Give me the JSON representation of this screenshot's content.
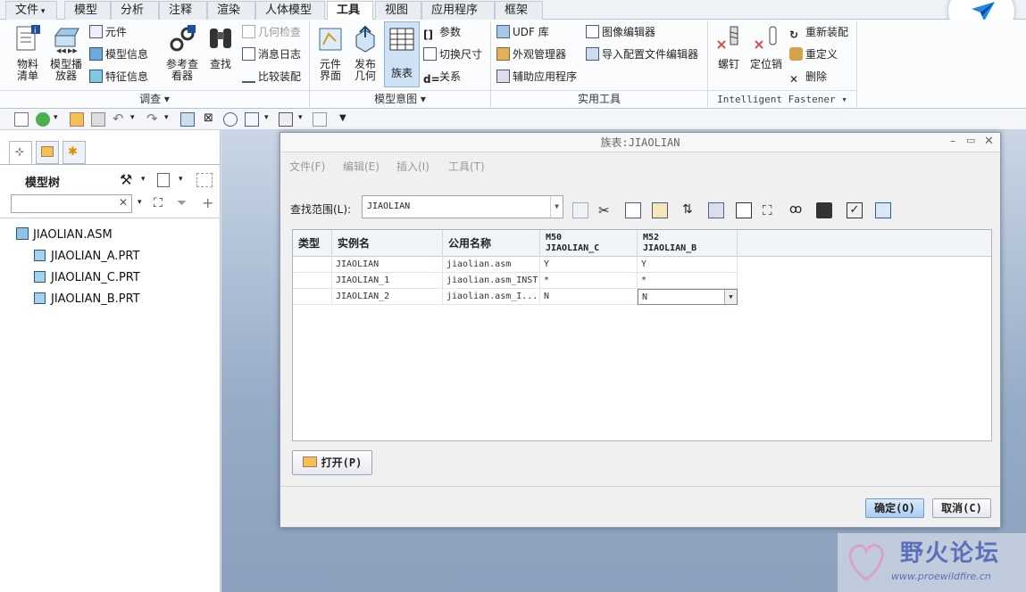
{
  "tabs": [
    "文件",
    "模型",
    "分析",
    "注释",
    "渲染",
    "人体模型",
    "工具",
    "视图",
    "应用程序",
    "框架"
  ],
  "active_tab": "工具",
  "ribbon": {
    "investigate": {
      "label": "调查",
      "bom": "物料\n清单",
      "model_player": "模型播\n放器",
      "component": "元件",
      "model_info": "模型信息",
      "feature_info": "特征信息",
      "ref_viewer": "参考查\n看器",
      "find": "查找",
      "geom_check": "几何检查",
      "message_log": "消息日志",
      "compare_asm": "比较装配"
    },
    "model_intent": {
      "label": "模型意图",
      "component_interface": "元件\n界面",
      "publish_geom": "发布\n几何",
      "family_table": "族表",
      "params": "参数",
      "switch_dims": "切换尺寸",
      "relations": "关系"
    },
    "utilities": {
      "label": "实用工具",
      "udf": "UDF 库",
      "appearance_mgr": "外观管理器",
      "aux_app": "辅助应用程序",
      "image_editor": "图像编辑器",
      "import_cfg_editor": "导入配置文件编辑器"
    },
    "fastener": {
      "label": "Intelligent Fastener",
      "screw": "螺钉",
      "dowel": "定位销",
      "reassemble": "重新装配",
      "redefine": "重定义",
      "delete": "删除"
    }
  },
  "left_panel": {
    "title": "模型树",
    "search_placeholder": "",
    "tree": [
      "JIAOLIAN.ASM",
      "JIAOLIAN_A.PRT",
      "JIAOLIAN_C.PRT",
      "JIAOLIAN_B.PRT"
    ]
  },
  "dialog": {
    "title": "族表:JIAOLIAN",
    "menus": [
      "文件(F)",
      "编辑(E)",
      "插入(I)",
      "工具(T)"
    ],
    "scope_label": "查找范围(L):",
    "scope_value": "JIAOLIAN",
    "columns": [
      "类型",
      "实例名",
      "公用名称"
    ],
    "col_m50_top": "M50",
    "col_m50_bottom": "JIAOLIAN_C",
    "col_m52_top": "M52",
    "col_m52_bottom": "JIAOLIAN_B",
    "rows": [
      {
        "type": "",
        "name": "JIAOLIAN",
        "common": "jiaolian.asm",
        "m50": "Y",
        "m52": "Y"
      },
      {
        "type": "",
        "name": "JIAOLIAN_1",
        "common": "jiaolian.asm_INST",
        "m50": "*",
        "m52": "*"
      },
      {
        "type": "",
        "name": "JIAOLIAN_2",
        "common": "jiaolian.asm_I...",
        "m50": "N",
        "m52": "N"
      }
    ],
    "open_label": "打开(P)",
    "ok_label": "确定(O)",
    "cancel_label": "取消(C)"
  },
  "watermark": {
    "title": "野火论坛",
    "url": "www.proewildfire.cn"
  },
  "colors": {
    "accent": "#3b7fd9",
    "watermark": "#5c6fb9"
  }
}
